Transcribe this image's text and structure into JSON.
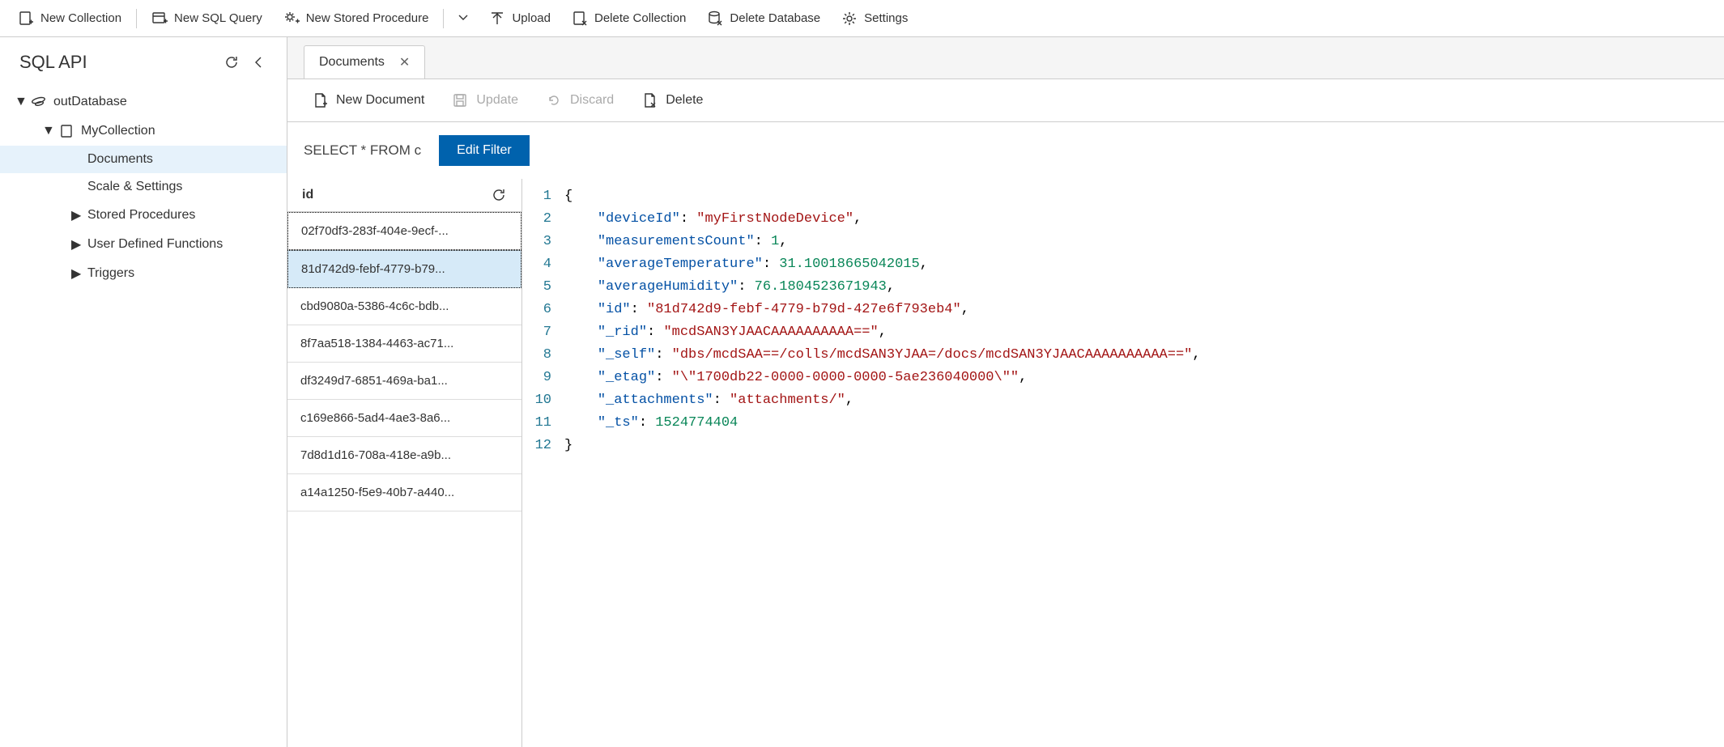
{
  "toolbar": {
    "newCollection": "New Collection",
    "newSqlQuery": "New SQL Query",
    "newStoredProc": "New Stored Procedure",
    "upload": "Upload",
    "deleteCollection": "Delete Collection",
    "deleteDatabase": "Delete Database",
    "settings": "Settings"
  },
  "sidebar": {
    "title": "SQL API",
    "database": "outDatabase",
    "collection": "MyCollection",
    "items": {
      "documents": "Documents",
      "scaleSettings": "Scale & Settings",
      "storedProcs": "Stored Procedures",
      "udfs": "User Defined Functions",
      "triggers": "Triggers"
    }
  },
  "tab": {
    "label": "Documents"
  },
  "docToolbar": {
    "newDocument": "New Document",
    "update": "Update",
    "discard": "Discard",
    "delete": "Delete"
  },
  "query": {
    "text": "SELECT * FROM c",
    "editFilter": "Edit Filter"
  },
  "idList": {
    "header": "id",
    "rows": [
      "02f70df3-283f-404e-9ecf-...",
      "81d742d9-febf-4779-b79...",
      "cbd9080a-5386-4c6c-bdb...",
      "8f7aa518-1384-4463-ac71...",
      "df3249d7-6851-469a-ba1...",
      "c169e866-5ad4-4ae3-8a6...",
      "7d8d1d16-708a-418e-a9b...",
      "a14a1250-f5e9-40b7-a440..."
    ],
    "selectedIndex": 1
  },
  "jsonDoc": {
    "deviceId": "myFirstNodeDevice",
    "measurementsCount": 1,
    "averageTemperature": 31.10018665042015,
    "averageHumidity": 76.1804523671943,
    "id": "81d742d9-febf-4779-b79d-427e6f793eb4",
    "_rid": "mcdSAN3YJAACAAAAAAAAAA==",
    "_self": "dbs/mcdSAA==/colls/mcdSAN3YJAA=/docs/mcdSAN3YJAACAAAAAAAAAA==",
    "_etag": "\\\"1700db22-0000-0000-0000-5ae236040000\\\"",
    "_attachments": "attachments/",
    "_ts": 1524774404
  }
}
